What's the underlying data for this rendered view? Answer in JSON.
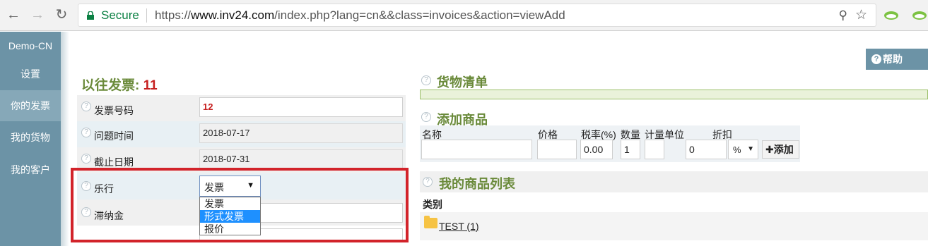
{
  "browser": {
    "secure_label": "Secure",
    "url_scheme": "https://",
    "url_host": "www.inv24.com",
    "url_path": "/index.php?lang=cn&&class=invoices&action=viewAdd"
  },
  "sidebar": {
    "items": [
      {
        "label": "Demo-CN"
      },
      {
        "label": "设置"
      },
      {
        "label": "你的发票"
      },
      {
        "label": "我的货物"
      },
      {
        "label": "我的客户"
      }
    ]
  },
  "help_button": {
    "label": "帮助"
  },
  "past_invoices": {
    "label": "以往发票:",
    "count": "11"
  },
  "form": {
    "invoice_number": {
      "label": "发票号码",
      "value": "12"
    },
    "issue_date": {
      "label": "问题时间",
      "value": "2018-07-17"
    },
    "due_date": {
      "label": "截止日期",
      "value": "2018-07-31"
    },
    "type": {
      "label": "乐行",
      "value": "发票",
      "options": [
        "发票",
        "形式发票",
        "报价"
      ],
      "highlighted": "形式发票"
    },
    "late_fee": {
      "label": "滞纳金"
    }
  },
  "goods_list": {
    "title": "货物清单"
  },
  "add_product": {
    "title": "添加商品",
    "columns": {
      "name": "名称",
      "price": "价格",
      "tax": "税率(%)",
      "qty": "数量",
      "unit": "计量单位",
      "discount": "折扣"
    },
    "values": {
      "name": "",
      "price": "",
      "tax": "0.00",
      "qty": "1",
      "unit": "",
      "discount": "0",
      "discount_type": "%"
    },
    "add_label": "添加"
  },
  "my_products": {
    "title": "我的商品列表",
    "category_header": "类别",
    "categories": [
      {
        "name": "TEST (1)"
      }
    ]
  },
  "colors": {
    "sidebar": "#6c93a6",
    "accent_green": "#6a8a3a",
    "highlight_red": "#d2232a",
    "count_red": "#c62020"
  }
}
